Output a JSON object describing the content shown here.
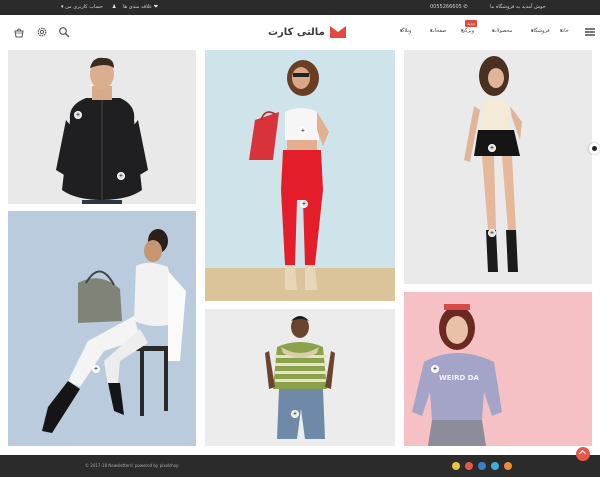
{
  "topbar": {
    "welcome": "خوش آمدید به فروشگاه ما",
    "phone": "0055266605",
    "wishlist": "علاقه مندی ها",
    "account": "حساب کاربری من"
  },
  "header": {
    "logo_text": "مالتی کارت",
    "nav": {
      "home": "خانه",
      "shop": "فروشگاه",
      "products": "محصولات",
      "features": "ویژگی",
      "pages": "صفحات",
      "blog": "وبلاگ"
    },
    "badge": "جدید",
    "icons": [
      "menu-icon",
      "search-icon",
      "settings-icon",
      "cart-icon"
    ]
  },
  "tiles": {
    "hotspot_symbol": "+"
  },
  "footer": {
    "copyright": "© 2017-18 Newsletters! powered by pixelshop"
  },
  "colors": {
    "accent": "#e34a3d",
    "dark": "#2b2b2b"
  }
}
